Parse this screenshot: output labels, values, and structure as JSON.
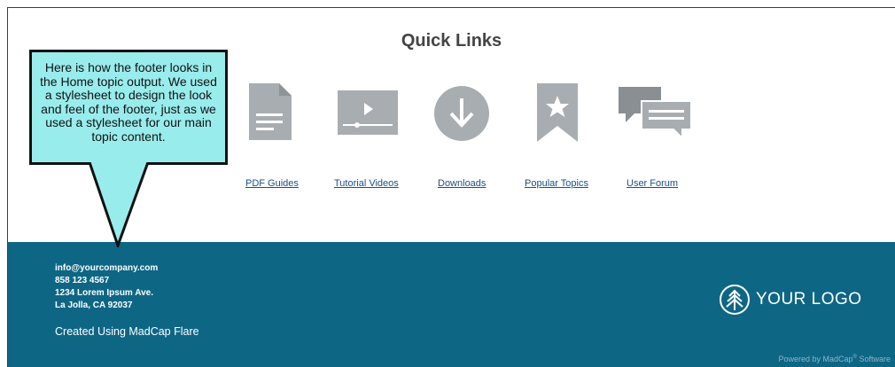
{
  "quick_links": {
    "title": "Quick Links",
    "items": [
      {
        "label": "PDF Guides",
        "icon": "document-icon"
      },
      {
        "label": "Tutorial Videos",
        "icon": "video-player-icon"
      },
      {
        "label": "Downloads",
        "icon": "download-icon"
      },
      {
        "label": "Popular Topics",
        "icon": "star-bookmark-icon"
      },
      {
        "label": "User Forum",
        "icon": "chat-bubbles-icon"
      }
    ]
  },
  "callout": {
    "text": "Here is how the footer looks in the Home topic output. We used a stylesheet to design the look and feel of the footer, just as we used a stylesheet for our main topic content."
  },
  "footer": {
    "email": "info@yourcompany.com",
    "phone": "858 123 4567",
    "address_line1": "1234 Lorem Ipsum Ave.",
    "address_line2": "La Jolla, CA 92037",
    "created": "Created Using MadCap Flare",
    "logo_text": "YOUR LOGO",
    "powered_text": "Powered by MadCap",
    "powered_reg": "®",
    "powered_suffix": " Software"
  },
  "colors": {
    "footer_bg": "#0e6685",
    "icon_gray": "#a8adb1",
    "link": "#1a4f8a",
    "callout_bg": "#99ecec"
  }
}
